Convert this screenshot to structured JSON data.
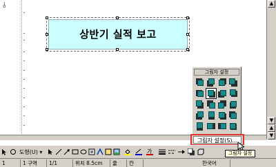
{
  "document": {
    "anchor_symbol": "⫰",
    "textbox_text": "상반기 실적 보고"
  },
  "palette": {
    "title": "그림자 설정",
    "selected_index": 5
  },
  "shadow_button": {
    "label": "그림자 설정(S)..."
  },
  "tooltip": {
    "label": "그림자 설정"
  },
  "toolbar": {
    "draw_label": "도형(U) ▾",
    "shapes_label": "도형(U)"
  },
  "statusbar": {
    "page": "1",
    "section": "1 구역",
    "pages": "1/1",
    "position": "위치 8.5cm",
    "line": "줄",
    "column": "칸",
    "language": "한국어"
  },
  "colors": {
    "textbox_fill": "#ccffff",
    "highlight": "#e03030",
    "shadow_teal": "#1a8a8a"
  }
}
